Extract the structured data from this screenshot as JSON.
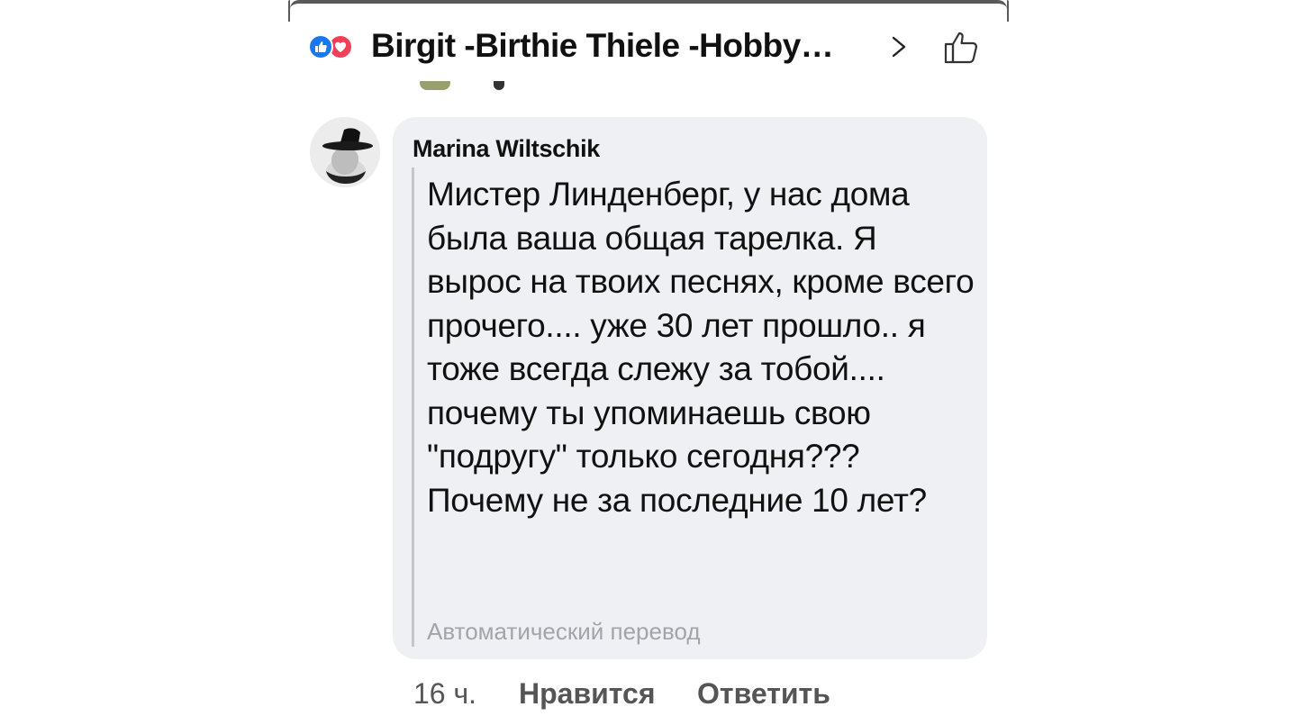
{
  "header": {
    "reactions": [
      "like-reaction",
      "love-reaction"
    ],
    "group_title": "Birgit -Birthie Thiele -Hobby…",
    "chevron_icon": "chevron-right-icon",
    "like_icon": "thumbs-up-icon"
  },
  "comment": {
    "author": "Marina Wiltschik",
    "text": "Мистер Линденберг, у нас дома была ваша общая тарелка. Я вырос на твоих песнях, кроме всего прочего.... уже 30 лет прошло.. я тоже всегда слежу за тобой.... почему ты упоминаешь свою \"подругу\" только сегодня??? Почему не за последние 10 лет?",
    "translation_label": "Автоматический перевод",
    "time": "16 ч.",
    "like_label": "Нравится",
    "reply_label": "Ответить"
  },
  "colors": {
    "bubble": "#eff0f4",
    "like_blue": "#1877f2",
    "love_red": "#f33e58",
    "meta_text": "#555555"
  }
}
